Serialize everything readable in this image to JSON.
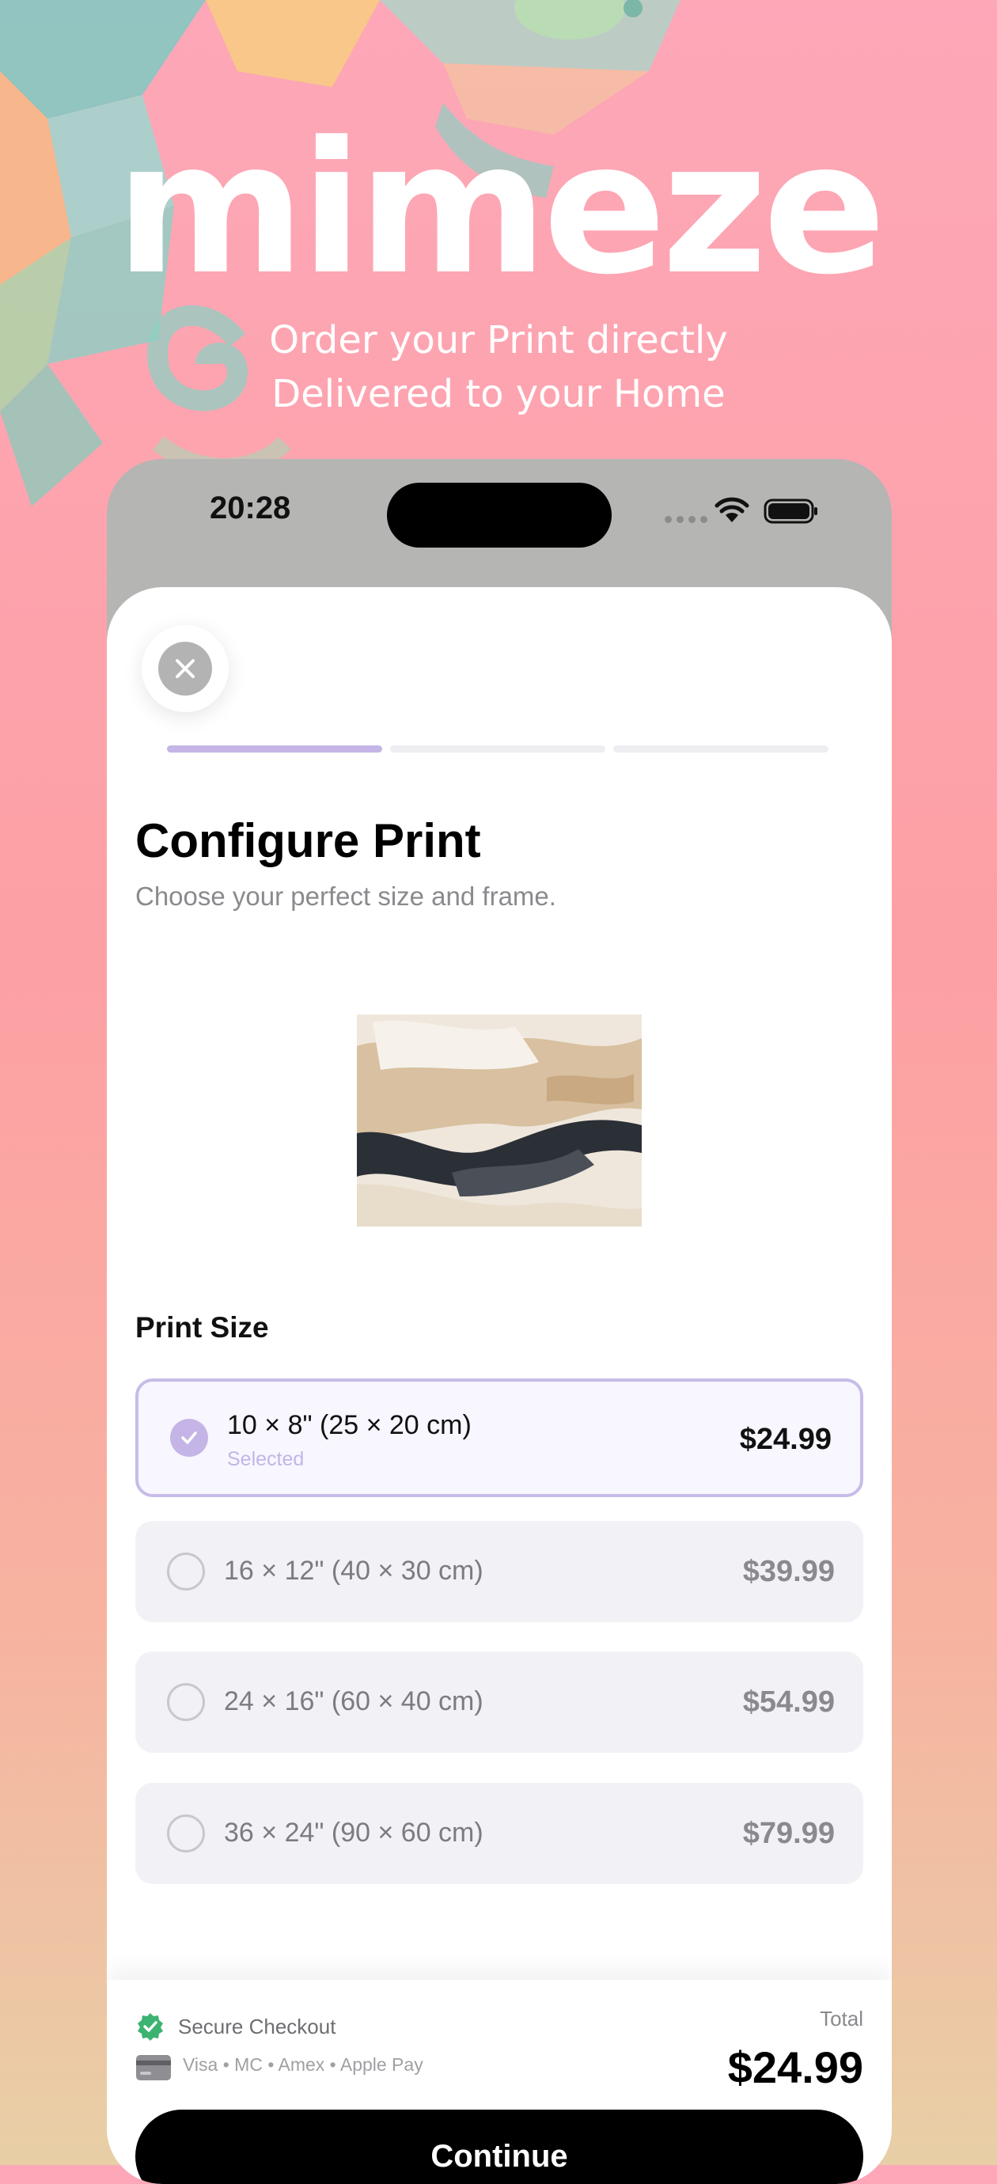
{
  "hero": {
    "brand": "mimeze",
    "tagline_line1": "Order your Print directly",
    "tagline_line2": "Delivered to your Home"
  },
  "status_bar": {
    "time": "20:28",
    "icons": [
      "signal-icon",
      "wifi-icon",
      "battery-icon"
    ]
  },
  "progress": {
    "current_step": 1,
    "total_steps": 3
  },
  "header": {
    "close_icon": "close-icon",
    "title": "Configure Print",
    "subtitle": "Choose your perfect size and frame."
  },
  "print_size": {
    "label": "Print Size",
    "options": [
      {
        "label": "10 × 8\" (25 × 20 cm)",
        "sublabel": "Selected",
        "price": "$24.99",
        "selected": true
      },
      {
        "label": "16 × 12\" (40 × 30 cm)",
        "price": "$39.99",
        "selected": false
      },
      {
        "label": "24 × 16\" (60 × 40 cm)",
        "price": "$54.99",
        "selected": false
      },
      {
        "label": "36 × 24\" (90 × 60 cm)",
        "price": "$79.99",
        "selected": false
      }
    ]
  },
  "footer": {
    "secure_label": "Secure Checkout",
    "payment_methods": "Visa • MC • Amex • Apple Pay",
    "total_label": "Total",
    "total_value": "$24.99",
    "continue_label": "Continue"
  },
  "colors": {
    "accent": "#c4b5e6",
    "secure_green": "#3cb371",
    "button": "#000000"
  }
}
